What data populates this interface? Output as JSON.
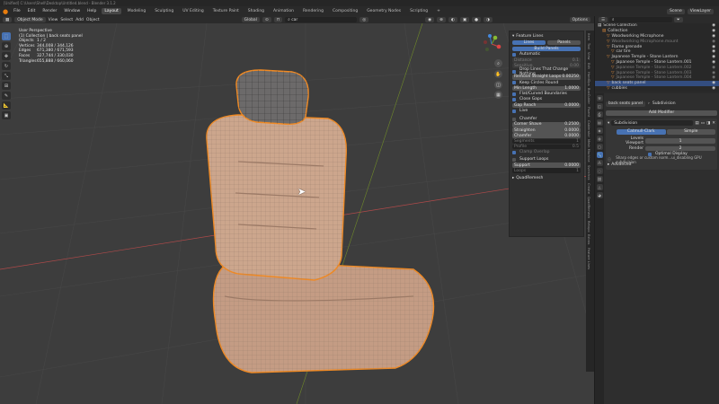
{
  "window": {
    "title": "[Unified] C:\\Users\\Shell\\Desktop\\Untitled.blend - Blender 3.1.2"
  },
  "menu": [
    "File",
    "Edit",
    "Render",
    "Window",
    "Help"
  ],
  "workspaces": [
    "Layout",
    "Modeling",
    "Sculpting",
    "UV Editing",
    "Texture Paint",
    "Shading",
    "Animation",
    "Rendering",
    "Compositing",
    "Geometry Nodes",
    "Scripting"
  ],
  "active_workspace": "Layout",
  "scene": {
    "scene_label": "Scene",
    "view_layer_label": "ViewLayer"
  },
  "viewport_header": {
    "mode": "Object Mode",
    "menus": [
      "View",
      "Select",
      "Add",
      "Object"
    ],
    "orientation": "Global",
    "search": "car",
    "options": "Options"
  },
  "overlay_info": {
    "perspective": "User Perspective",
    "collection": "(1) Collection | back seats panel",
    "stats": [
      {
        "k": "Objects",
        "v": "1 / 2"
      },
      {
        "k": "Vertices",
        "v": "344,008 / 344,126"
      },
      {
        "k": "Edges",
        "v": "671,380 / 671,593"
      },
      {
        "k": "Faces",
        "v": "327,744 / 330,030"
      },
      {
        "k": "Triangles",
        "v": "655,888 / 660,060"
      }
    ]
  },
  "feature_lines": {
    "title": "Feature Lines",
    "buttons": [
      "Lines",
      "Panels"
    ],
    "build": "Build Panels",
    "automatic": "Automatic",
    "dim_fields": [
      {
        "label": "Distance",
        "value": "0.1"
      },
      {
        "label": "Sensitive",
        "value": "0.00"
      }
    ],
    "drop_lines": "Drop Lines That Change Nothing",
    "remove_straight": {
      "label": "Remove Straight Loops",
      "value": "0.00250"
    },
    "keep_circles": "Keep Circles Round",
    "min_length": {
      "label": "Min Length",
      "value": "1.0000"
    },
    "flat_curved": "Flat/Curved Boundaries",
    "close_gaps": "Close Gaps",
    "gap_reach": {
      "label": "Gap Reach",
      "value": "0.0000"
    },
    "live": "Live",
    "chamfer": {
      "title": "Chamfer",
      "fields": [
        {
          "label": "Corner Shave",
          "value": "0.2500"
        },
        {
          "label": "Straighten",
          "value": "0.0000"
        },
        {
          "label": "Chamfer",
          "value": "0.0000"
        }
      ],
      "dim_fields": [
        {
          "label": "Segments",
          "value": "1"
        },
        {
          "label": "Profile",
          "value": "0.5"
        }
      ],
      "clamp": "Clamp Overlap"
    },
    "support_loops": {
      "title": "Support Loops",
      "field": {
        "label": "Support",
        "value": "0.0000"
      },
      "dim": {
        "label": "Loops",
        "value": "1"
      }
    },
    "quadremesh": "QuadRemesh"
  },
  "npanel_tabs": [
    "Item",
    "Tool",
    "View",
    "Edit",
    "HardOps",
    "BoxCutter",
    "Fluent",
    "Cablerator",
    "Mesh Machine",
    "Sverchok",
    "Create",
    "QuadRemesh",
    "Retopo",
    "Extras",
    "Feature Lines"
  ],
  "outliner": {
    "rows": [
      {
        "label": "Scene Collection",
        "indent": 0,
        "dim": false,
        "sel": false
      },
      {
        "label": "Collection",
        "indent": 1,
        "dim": false,
        "sel": false
      },
      {
        "label": "Woodworking Microphone",
        "indent": 2,
        "dim": false,
        "sel": false
      },
      {
        "label": "Woodworking Microphone.mount",
        "indent": 2,
        "dim": true,
        "sel": false
      },
      {
        "label": "Flame grenade",
        "indent": 2,
        "dim": false,
        "sel": false
      },
      {
        "label": "car tire",
        "indent": 3,
        "dim": false,
        "sel": false
      },
      {
        "label": "Japanese Temple - Stone Lantern",
        "indent": 2,
        "dim": false,
        "sel": false
      },
      {
        "label": "Japanese Temple - Stone Lantern.001",
        "indent": 3,
        "dim": false,
        "sel": false
      },
      {
        "label": "Japanese Temple - Stone Lantern.002",
        "indent": 3,
        "dim": true,
        "sel": false
      },
      {
        "label": "Japanese Temple - Stone Lantern.003",
        "indent": 3,
        "dim": true,
        "sel": false
      },
      {
        "label": "Japanese Temple - Stone Lantern.004",
        "indent": 3,
        "dim": true,
        "sel": false
      },
      {
        "label": "back seats panel",
        "indent": 2,
        "dim": false,
        "sel": true
      },
      {
        "label": "cubbies",
        "indent": 2,
        "dim": false,
        "sel": false
      }
    ]
  },
  "properties": {
    "object_name": "back seats panel",
    "modifier_stack_name": "Subdivision",
    "add_modifier": "Add Modifier",
    "modifier": {
      "name": "Subdivision",
      "types": [
        "Catmull-Clark",
        "Simple"
      ],
      "active_type": "Catmull-Clark",
      "fields": [
        {
          "label": "Levels Viewport",
          "value": "1"
        },
        {
          "label": "Render",
          "value": "2"
        }
      ],
      "optimal_display": "Optimal Display",
      "gpu_note": "Sharp edges or custom norm...ui_disabling GPU subdivision",
      "advanced": "Advanced"
    }
  },
  "colors": {
    "accent": "#4772b3",
    "orange": "#f08a24",
    "seat": "#c79f85"
  }
}
